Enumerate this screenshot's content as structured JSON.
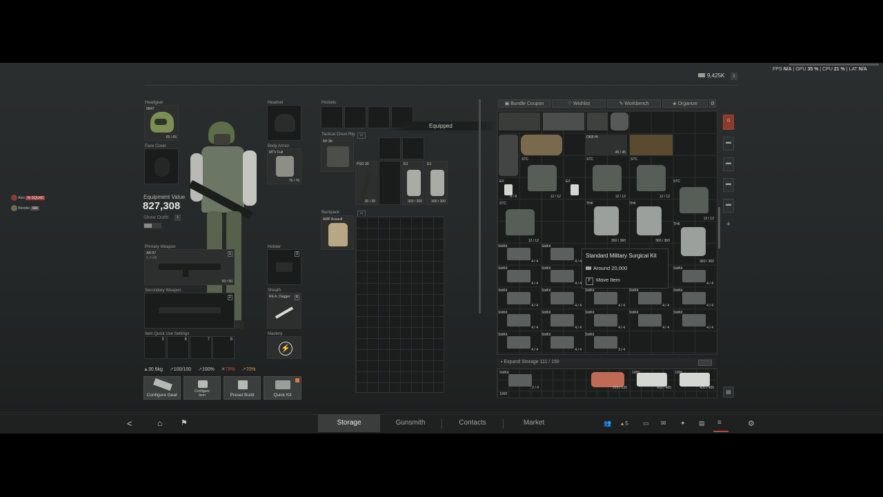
{
  "overlay": {
    "perf": {
      "fps_label": "FPS",
      "fps_value": "N/A",
      "gpu_label": "GPU",
      "gpu_value": "35 %",
      "cpu_label": "CPU",
      "cpu_value": "21 %",
      "lat_label": "LAT",
      "lat_value": "N/A"
    },
    "currency": "9,425K",
    "info_icon": "i"
  },
  "party": [
    {
      "name": "Alex",
      "tag": "IN SQUAD"
    },
    {
      "name": "Blondie",
      "tag": "SIR"
    }
  ],
  "equipment": {
    "headgear_label": "Headgear",
    "headgear_item": "6B47",
    "headgear_count": "65 / 65",
    "headset_label": "Headset",
    "face_cover_label": "Face Cover",
    "body_armor_label": "Body Armor",
    "body_armor_item": "MTV Full",
    "body_armor_count": "76 / 76",
    "value_label": "Equipment Value",
    "value": "827,308",
    "show_outfit_label": "Show Outfit",
    "primary_label": "Primary Weapon",
    "primary_item": "AR-57",
    "primary_sub": "5.7×28",
    "primary_count": "50 / 50",
    "primary_slot": "1",
    "secondary_label": "Secondary Weapon",
    "secondary_slot": "2",
    "holster_label": "Holster",
    "holster_slot": "3",
    "sheath_label": "Sheath",
    "sheath_item": "RE A. Dagger",
    "sheath_slot": "4",
    "quickuse_label": "Item Quick Use Settings",
    "quickuse_slots": [
      "5",
      "6",
      "7",
      "8"
    ],
    "mastery_label": "Mastery"
  },
  "stats": {
    "weight": "30.6kg",
    "stamina": "100/100",
    "hydration": "100%",
    "energy": "79%",
    "ergo": "70%"
  },
  "actions": [
    "Configure Gear",
    "Configure Item",
    "Preset Build",
    "Quick Kit"
  ],
  "rig": {
    "pockets_label": "Pockets",
    "tactical_label": "Tactical Chest Rig",
    "tactical_item": "6H-3b",
    "equipped_label": "Equipped",
    "rig_items": [
      {
        "name": "PSO 30",
        "count": "30 / 30"
      },
      {
        "name": "E3",
        "count": "300 / 300"
      },
      {
        "name": "E3",
        "count": "300 / 300"
      }
    ],
    "backpack_label": "Backpack",
    "backpack_item": "AMP Assault"
  },
  "storage": {
    "tabs": [
      "Bundle Coupon",
      "Wishlist",
      "Workbench",
      "Organize"
    ],
    "row_labels": [
      "STC",
      "STC",
      "STC",
      "STC",
      "STC",
      "STC",
      "THK",
      "THK",
      "THK",
      "EX",
      "EX",
      "OKB Hi"
    ],
    "counts": {
      "stc": "12 / 12",
      "thk": "360 / 360",
      "kit": "4 / 4",
      "kit_last": "3 / 4",
      "okb": "45 / 45",
      "ex": "8 / 8"
    },
    "kit_label": "StdKit",
    "expand_label": "Expand Storage",
    "expand_value": "111 / 150",
    "bottom_counts": [
      "2 / 4",
      "220 / 220",
      "400 / 400",
      "400 / 400"
    ],
    "bottom_labels": [
      "StdKit",
      "1000",
      "1000",
      "1000"
    ]
  },
  "tooltip": {
    "title": "Standard Military Surgical Kit",
    "price": "Around 20,000",
    "key": "F",
    "action": "Move Item"
  },
  "nav": {
    "tabs": [
      "Storage",
      "Gunsmith",
      "Contacts",
      "Market"
    ],
    "active": "Storage",
    "party_count": "5"
  }
}
